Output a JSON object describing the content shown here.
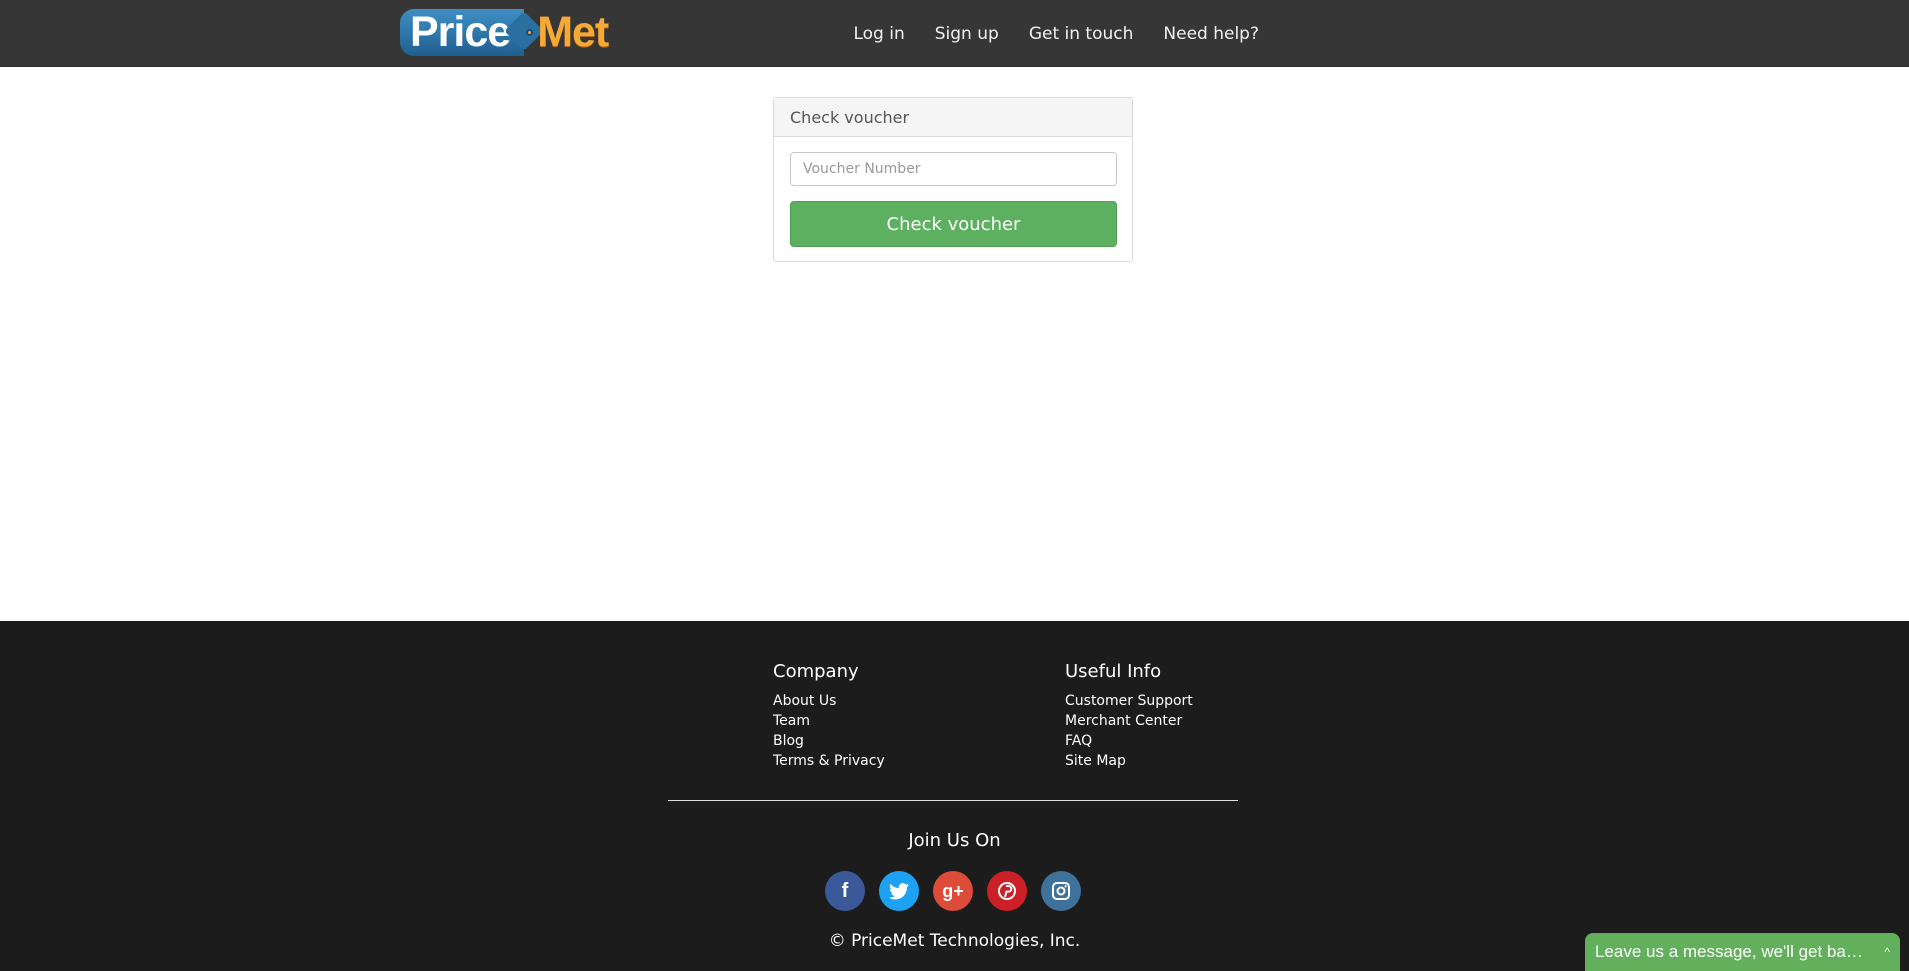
{
  "header": {
    "logo": {
      "part1": "Price",
      "part2": "Met"
    },
    "nav": [
      {
        "label": "Log in"
      },
      {
        "label": "Sign up"
      },
      {
        "label": "Get in touch"
      },
      {
        "label": "Need help?"
      }
    ]
  },
  "voucher": {
    "heading": "Check voucher",
    "input_placeholder": "Voucher Number",
    "input_value": "",
    "button_label": "Check voucher"
  },
  "footer": {
    "company": {
      "title": "Company",
      "links": [
        "About Us",
        "Team",
        "Blog",
        "Terms & Privacy"
      ]
    },
    "useful_info": {
      "title": "Useful Info",
      "links": [
        "Customer Support",
        "Merchant Center",
        "FAQ",
        "Site Map"
      ]
    },
    "join_title": "Join Us On",
    "social": [
      {
        "icon": "facebook-icon",
        "glyph": "f",
        "color": "#3b5998"
      },
      {
        "icon": "twitter-icon",
        "glyph": "🐦",
        "color": "#1da1f2"
      },
      {
        "icon": "google-plus-icon",
        "glyph": "g+",
        "color": "#dd4b39"
      },
      {
        "icon": "pinterest-icon",
        "glyph": "P",
        "color": "#cb2027"
      },
      {
        "icon": "instagram-icon",
        "glyph": "◎",
        "color": "#3f729b"
      }
    ],
    "copyright": "© PriceMet Technologies, Inc."
  },
  "chat_widget": {
    "label": "Leave us a message, we'll get back to you",
    "chevron": "^"
  },
  "colors": {
    "navbar": "#363636",
    "footer": "#1c1c1c",
    "primary_button": "#5cb060",
    "logo_blue": "#2a6f9f",
    "logo_orange": "#f6a934"
  }
}
